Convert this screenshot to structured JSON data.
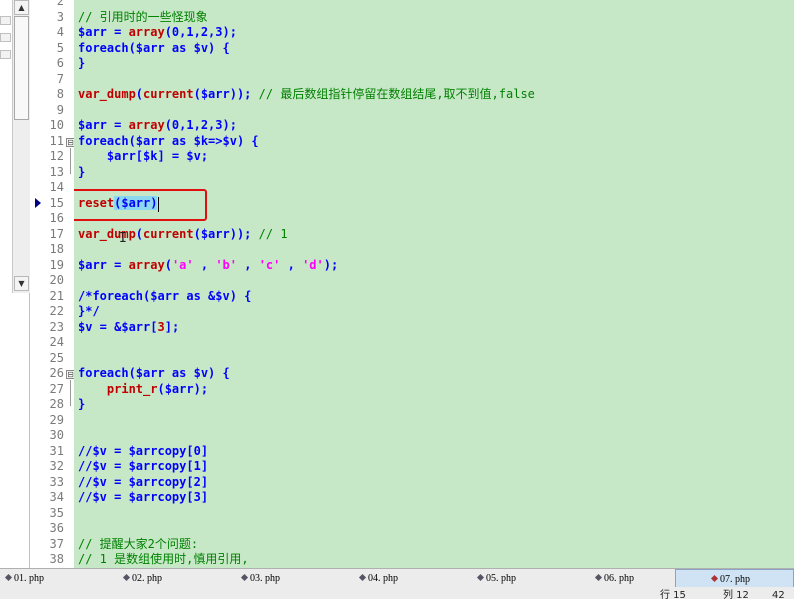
{
  "gutter": {
    "lines": [
      "2",
      "3",
      "4",
      "5",
      "6",
      "7",
      "8",
      "9",
      "10",
      "11",
      "12",
      "13",
      "14",
      "15",
      "16",
      "17",
      "18",
      "19",
      "20",
      "21",
      "22",
      "23",
      "24",
      "25",
      "26",
      "27",
      "28",
      "29",
      "30",
      "31",
      "32",
      "33",
      "34",
      "35",
      "36",
      "37",
      "38"
    ],
    "fold_open": "⊟",
    "fold_close": "⊟"
  },
  "code": {
    "l3": "// 引用时的一些怪现象",
    "l4_a": "$arr = ",
    "l4_b": "array",
    "l4_c": "(0,1,2,3);",
    "l5": "foreach($arr as $v) {",
    "l6": "}",
    "l8_a": "var_dump",
    "l8_b": "(",
    "l8_c": "current",
    "l8_d": "($arr)); ",
    "l8_e": "// 最后数组指针停留在数组结尾,取不到值,false",
    "l10_a": "$arr = ",
    "l10_b": "array",
    "l10_c": "(0,1,2,3);",
    "l11": "foreach($arr as $k=>$v) {",
    "l12": "    $arr[$k] = $v;",
    "l13": "}",
    "l15_a": "reset",
    "l15_b": "($arr",
    "l15_c": ")",
    "l17_a": "var_dump",
    "l17_b": "(",
    "l17_c": "current",
    "l17_d": "($arr)); ",
    "l17_e": "// 1",
    "l19_a": "$arr = ",
    "l19_b": "array",
    "l19_c": "(",
    "l19_d": "'a'",
    "l19_e": " , ",
    "l19_f": "'b'",
    "l19_g": " , ",
    "l19_h": "'c'",
    "l19_i": " , ",
    "l19_j": "'d'",
    "l19_k": ");",
    "l21": "/*foreach($arr as &$v) {",
    "l22": "}*/",
    "l23_a": "$v = &$arr[",
    "l23_b": "3",
    "l23_c": "];",
    "l26": "foreach($arr as $v) {",
    "l27_a": "    ",
    "l27_b": "print_r",
    "l27_c": "($arr);",
    "l28": "}",
    "l31": "//$v = $arrcopy[0]",
    "l32": "//$v = $arrcopy[1]",
    "l33": "//$v = $arrcopy[2]",
    "l34": "//$v = $arrcopy[3]",
    "l37": "// 提醒大家2个问题:",
    "l38": "// 1 是数组使用时,慎用引用,"
  },
  "tabs": [
    {
      "label": "01. php",
      "active": false
    },
    {
      "label": "02. php",
      "active": false
    },
    {
      "label": "03. php",
      "active": false
    },
    {
      "label": "04. php",
      "active": false
    },
    {
      "label": "05. php",
      "active": false
    },
    {
      "label": "06. php",
      "active": false
    },
    {
      "label": "07. php",
      "active": true
    }
  ],
  "status": {
    "line": "行 15",
    "col": "列 12",
    "extra": "42"
  },
  "colors": {
    "editor_bg": "#c7e8c7",
    "keyword": "#0000ff",
    "function": "#c00000",
    "comment": "#008000",
    "string": "#ff00ff",
    "highlight_box": "#e01010"
  }
}
